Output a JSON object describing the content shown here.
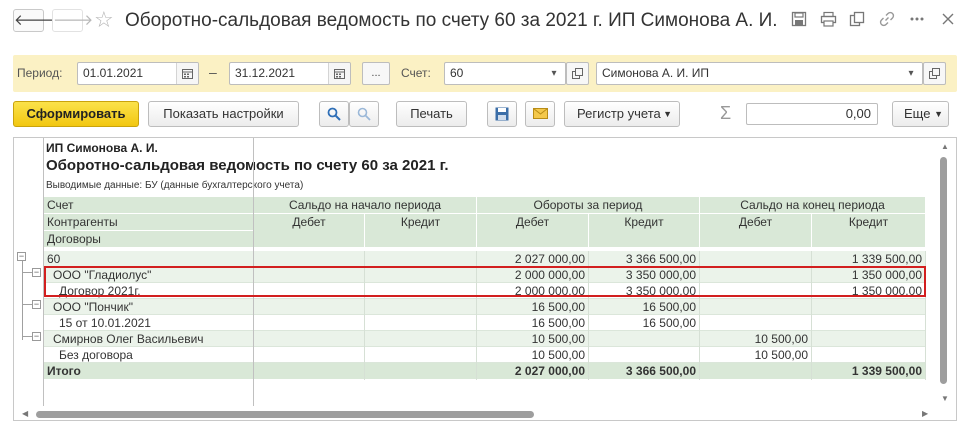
{
  "window": {
    "title": "Оборотно-сальдовая ведомость по счету 60 за 2021 г. ИП Симонова А. И.",
    "back_glyph": "🡐",
    "forward_glyph": "🡒",
    "star_glyph": "☆",
    "icons": [
      "save-icon",
      "print-icon",
      "copy-icon",
      "link-icon",
      "more-icon",
      "close-icon"
    ]
  },
  "filters": {
    "period_label": "Период:",
    "date_from": "01.01.2021",
    "dash": "–",
    "date_to": "31.12.2021",
    "ellipsis": "...",
    "account_label": "Счет:",
    "account": "60",
    "organization": "Симонова А. И. ИП"
  },
  "toolbar": {
    "generate": "Сформировать",
    "show_settings": "Показать настройки",
    "print": "Печать",
    "register": "Регистр учета",
    "sum_sign": "Σ",
    "sum_value": "0,00",
    "more": "Еще"
  },
  "report": {
    "org": "ИП Симонова А. И.",
    "title": "Оборотно-сальдовая ведомость по счету 60 за 2021 г.",
    "output_data": "Выводимые данные:   БУ (данные бухгалтерского учета)",
    "headers": {
      "account": "Счет",
      "contractors": "Контрагенты",
      "contracts": "Договоры",
      "opening": "Сальдо на начало периода",
      "turnover": "Обороты за период",
      "closing": "Сальдо на конец периода",
      "debit": "Дебет",
      "credit": "Кредит"
    },
    "rows": [
      {
        "label": "60",
        "d2": "2 027 000,00",
        "c2": "3 366 500,00",
        "d3": "",
        "c3": "1 339 500,00"
      },
      {
        "label": "ООО \"Гладиолус\"",
        "d2": "2 000 000,00",
        "c2": "3 350 000,00",
        "d3": "",
        "c3": "1 350 000,00"
      },
      {
        "label": "Договор 2021г.",
        "d2": "2 000 000,00",
        "c2": "3 350 000,00",
        "d3": "",
        "c3": "1 350 000,00"
      },
      {
        "label": "ООО \"Пончик\"",
        "d2": "16 500,00",
        "c2": "16 500,00",
        "d3": "",
        "c3": ""
      },
      {
        "label": "15 от 10.01.2021",
        "d2": "16 500,00",
        "c2": "16 500,00",
        "d3": "",
        "c3": ""
      },
      {
        "label": "Смирнов Олег Васильевич",
        "d2": "10 500,00",
        "c2": "",
        "d3": "10 500,00",
        "c3": ""
      },
      {
        "label": "Без договора",
        "d2": "10 500,00",
        "c2": "",
        "d3": "10 500,00",
        "c3": ""
      }
    ],
    "total": {
      "label": "Итого",
      "d2": "2 027 000,00",
      "c2": "3 366 500,00",
      "d3": "",
      "c3": "1 339 500,00"
    }
  },
  "colors": {
    "header_bg": "#d9e8d7",
    "filter_bg": "#fbf1c4",
    "primary_button": "#f5cf1c",
    "highlight_border": "#d21f1f"
  }
}
